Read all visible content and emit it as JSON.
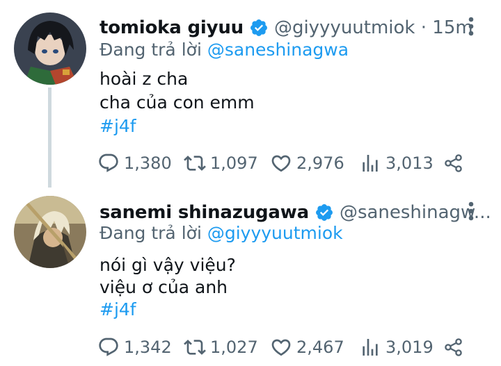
{
  "tweets": [
    {
      "name": "tomioka giyuu",
      "handle_meta": "@giyyyuutmiok · 15m",
      "reply_prefix": "Đang trả lời",
      "reply_mention": "@saneshinagwa",
      "lines": [
        "hoài z cha",
        "cha của con emm"
      ],
      "hashtag": "#j4f",
      "stats": {
        "replies": "1,380",
        "retweets": "1,097",
        "likes": "2,976",
        "views": "3,013"
      }
    },
    {
      "name": "sanemi shinazugawa",
      "handle_meta": "@saneshinagw...",
      "reply_prefix": "Đang trả lời",
      "reply_mention": "@giyyyuutmiok",
      "lines": [
        "nói gì vậy việu?",
        "việu ơ của anh"
      ],
      "hashtag": "#j4f",
      "stats": {
        "replies": "1,342",
        "retweets": "1,027",
        "likes": "2,467",
        "views": "3,019"
      }
    }
  ],
  "icons": {
    "verified": "verified-badge-icon",
    "more": "more-vertical-icon",
    "reply": "reply-icon",
    "retweet": "retweet-icon",
    "like": "heart-icon",
    "views": "analytics-icon",
    "share": "share-icon"
  },
  "colors": {
    "accent": "#1d9bf0",
    "text": "#0f1419",
    "muted": "#536471",
    "thread": "#cfd9de"
  }
}
